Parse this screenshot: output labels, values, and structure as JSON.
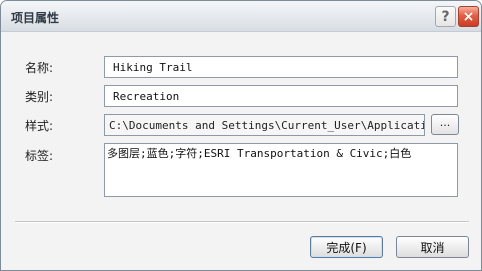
{
  "window": {
    "title": "项目属性",
    "help_label": "?",
    "close_label": "×"
  },
  "form": {
    "name_label": "名称:",
    "name_value": "Hiking Trail",
    "category_label": "类别:",
    "category_value": "Recreation",
    "style_label": "样式:",
    "style_value": "C:\\Documents and Settings\\Current_User\\Application D:",
    "browse_label": "...",
    "tags_label": "标签:",
    "tags_value": "多图层;蓝色;字符;ESRI Transportation & Civic;白色"
  },
  "buttons": {
    "finish_label": "完成(F)",
    "cancel_label": "取消"
  }
}
